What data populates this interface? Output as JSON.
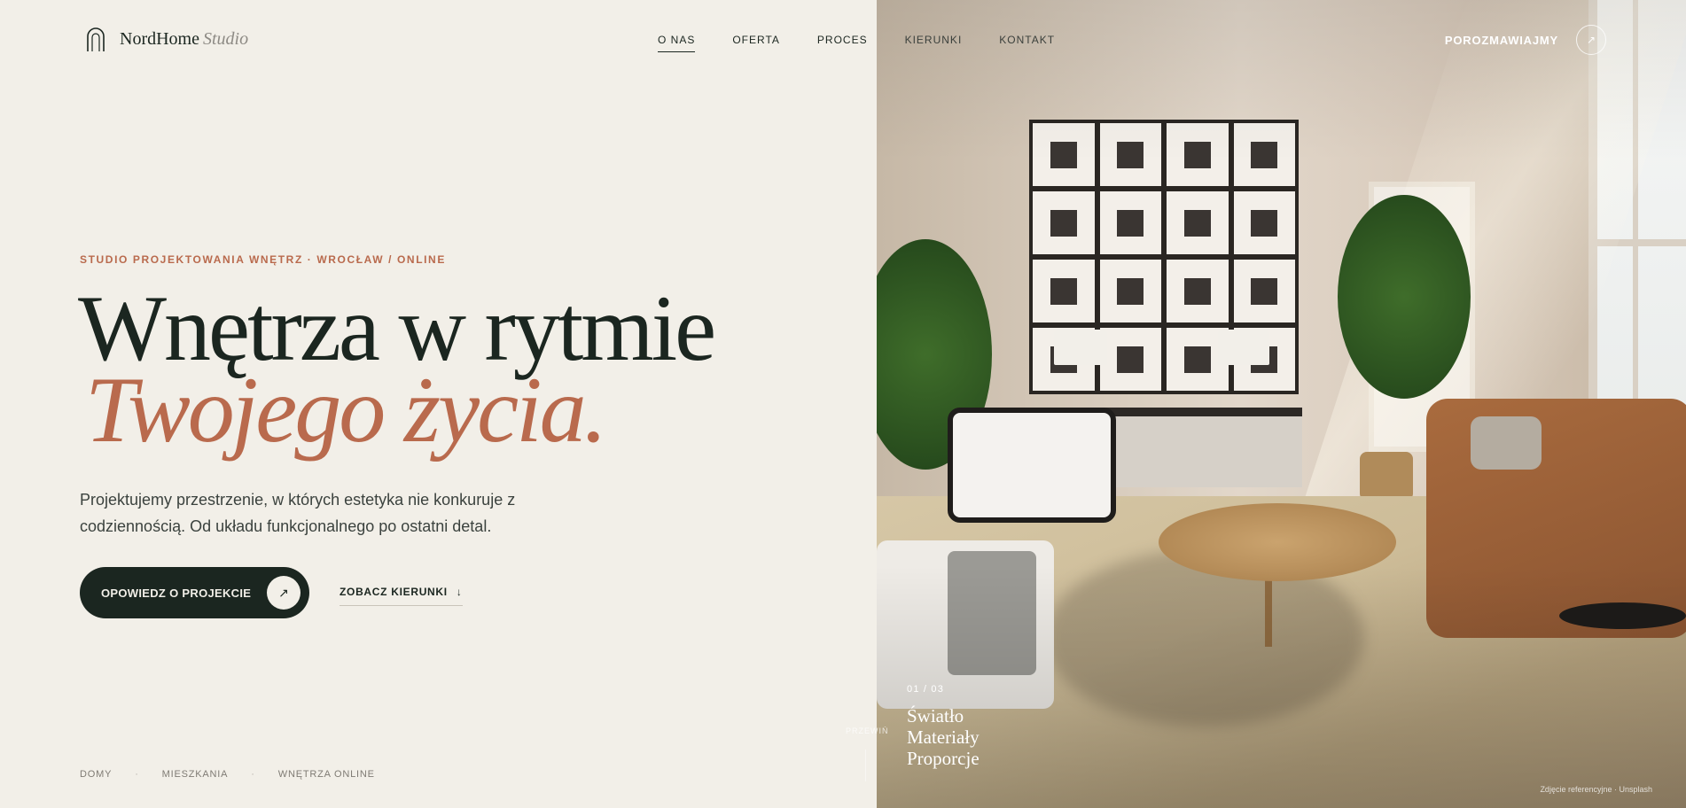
{
  "brand": {
    "name": "NordHome",
    "sub": "Studio"
  },
  "nav": {
    "items": [
      {
        "label": "O NAS",
        "active": true
      },
      {
        "label": "OFERTA"
      },
      {
        "label": "PROCES"
      },
      {
        "label": "KIERUNKI"
      },
      {
        "label": "KONTAKT"
      }
    ],
    "cta_label": "POROZMAWIAJMY",
    "cta_icon": "↗"
  },
  "hero": {
    "eyebrow": "STUDIO PROJEKTOWANIA WNĘTRZ · WROCŁAW / ONLINE",
    "title_line1": "Wnętrza w rytmie",
    "title_line2": "Twojego życia.",
    "lead": "Projektujemy przestrzenie, w których estetyka nie konkuruje z codziennością. Od układu funkcjonalnego po ostatni detal.",
    "primary_cta": "OPOWIEDZ O PROJEKCIE",
    "primary_icon": "↗",
    "secondary_cta": "ZOBACZ KIERUNKI",
    "secondary_icon": "↓"
  },
  "categories": [
    "DOMY",
    "MIESZKANIA",
    "WNĘTRZA ONLINE"
  ],
  "slider": {
    "counter": "01 / 03",
    "items": [
      "Światło",
      "Materiały",
      "Proporcje"
    ],
    "hint": "PRZEWIŃ",
    "credit": "Zdjęcie referencyjne · Unsplash"
  },
  "colors": {
    "accent": "#b96a4d",
    "ink": "#1b2620",
    "background": "#f2efe8"
  }
}
